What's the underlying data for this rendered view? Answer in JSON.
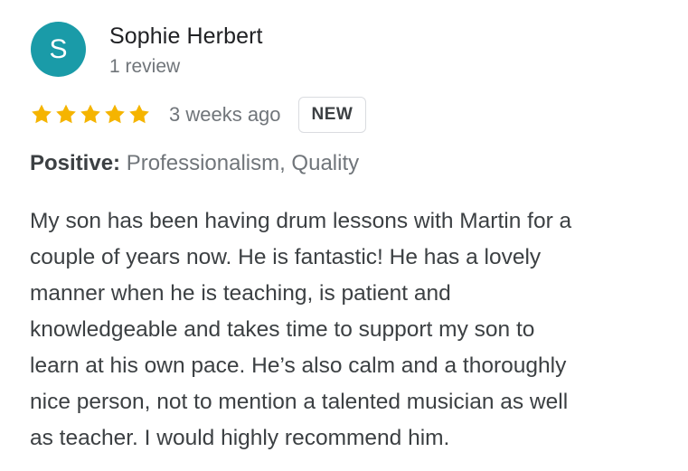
{
  "reviewer": {
    "avatar_initial": "S",
    "avatar_color": "#1a9ba8",
    "name": "Sophie Herbert",
    "review_count": "1 review"
  },
  "rating": {
    "stars": 5,
    "max_stars": 5,
    "star_icon": "star-icon",
    "star_color": "#f5b400",
    "date": "3 weeks ago",
    "badge": "NEW"
  },
  "attributes": {
    "label": "Positive:",
    "values": "Professionalism, Quality"
  },
  "review": {
    "lines": [
      "My son has been having drum lessons with Martin for a",
      "couple of years now. He is fantastic! He has a lovely",
      "manner when he is teaching, is patient and",
      "knowledgeable and takes time to support my son to",
      "learn at his own pace. He’s also calm and a thoroughly",
      "nice person, not to mention a talented musician as well",
      "as teacher. I would highly recommend him."
    ]
  }
}
